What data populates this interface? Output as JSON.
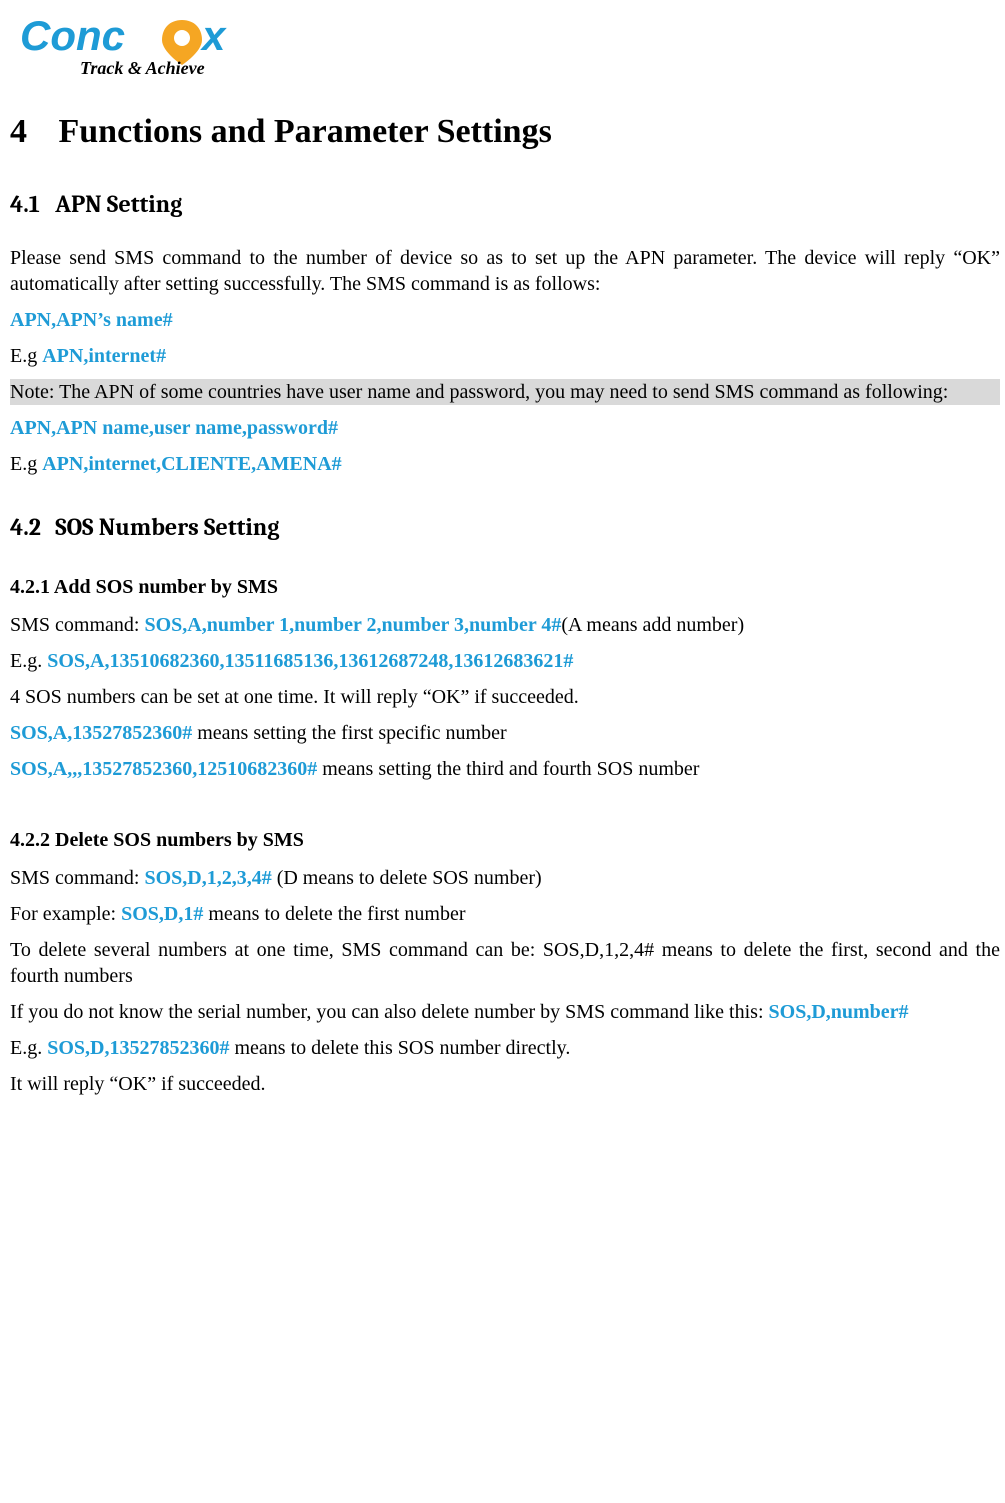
{
  "logo": {
    "brand": "Concox",
    "tagline": "Track & Achieve"
  },
  "h1_num": "4",
  "h1_title": "Functions and Parameter Settings",
  "s41": {
    "num": "4.1",
    "title": "APN Setting",
    "intro": "Please send SMS command to the number of device so as to set up the APN parameter. The device will reply “OK” automatically after setting successfully. The SMS command is as follows:",
    "cmd1": "APN,APN’s name#",
    "eg1_prefix": "E.g ",
    "eg1_cmd": "APN,internet#",
    "note": "Note: The APN of some countries have user name and password, you may need to send SMS command as following:",
    "cmd2": "APN,APN name,user name,password#",
    "eg2_prefix": "E.g ",
    "eg2_cmd": "APN,internet,CLIENTE,AMENA#"
  },
  "s42": {
    "num": "4.2",
    "title": "SOS Numbers Setting",
    "s421": {
      "heading": "4.2.1 Add SOS number by SMS",
      "p1_prefix": "SMS command: ",
      "p1_cmd": "SOS,A,number 1,number 2,number 3,number 4#",
      "p1_suffix": "(A means add number)",
      "p2_prefix": "E.g. ",
      "p2_cmd": "SOS,A,13510682360,13511685136,13612687248,13612683621#",
      "p3": "4 SOS numbers can be set at one time. It will reply “OK” if succeeded.",
      "p4_cmd": "SOS,A,13527852360#",
      "p4_suffix": " means setting the first specific number",
      "p5_cmd": "SOS,A,,,13527852360,12510682360#",
      "p5_suffix": " means setting the third and fourth SOS number"
    },
    "s422": {
      "heading": "4.2.2 Delete SOS numbers by SMS",
      "p1_prefix": "SMS command: ",
      "p1_cmd": "SOS,D,1,2,3,4#",
      "p1_suffix": " (D means to delete SOS number)",
      "p2_prefix": "For example: ",
      "p2_cmd": "SOS,D,1#",
      "p2_suffix": " means to delete the first number",
      "p3": "To delete several numbers at one time, SMS command can be: SOS,D,1,2,4# means to delete the first, second and the fourth numbers",
      "p4_prefix": "If you do not know the serial number, you can also delete number by SMS command like this: ",
      "p4_cmd": "SOS,D,number#",
      "p5_prefix": "E.g. ",
      "p5_cmd": "SOS,D,13527852360#",
      "p5_suffix": " means to delete this SOS number directly.",
      "p6": "It will reply “OK” if succeeded."
    }
  }
}
